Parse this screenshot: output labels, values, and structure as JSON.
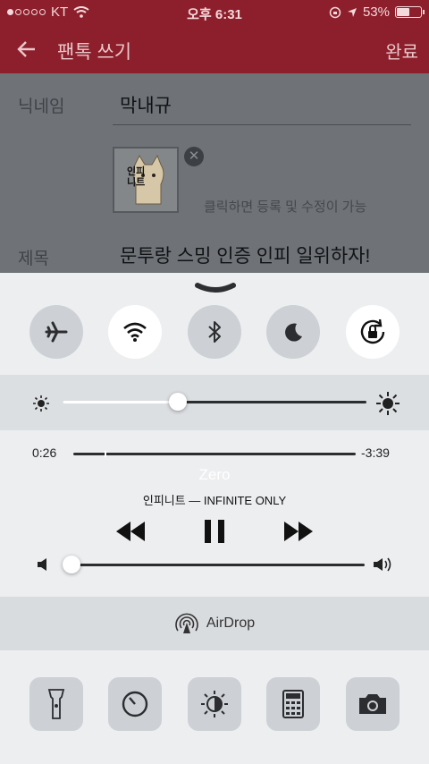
{
  "status_bar": {
    "carrier": "KT",
    "time": "오후 6:31",
    "battery": "53%",
    "battery_level": 0.53
  },
  "navbar": {
    "back_icon": "back-arrow-icon",
    "title": "팬톡 쓰기",
    "done_label": "완료"
  },
  "form": {
    "nickname_label": "닉네임",
    "nickname_value": "막내규",
    "image_hint": "클릭하면 등록 및 수정이 가능",
    "image_caption": "인피니트",
    "subject_label": "제목",
    "subject_value": "문투랑 스밍 인증 인피 일위하자!"
  },
  "control_center": {
    "toggles": [
      {
        "name": "airplane-mode",
        "icon": "airplane-icon",
        "on": false
      },
      {
        "name": "wifi",
        "icon": "wifi-icon",
        "on": true
      },
      {
        "name": "bluetooth",
        "icon": "bluetooth-icon",
        "on": false
      },
      {
        "name": "do-not-disturb",
        "icon": "moon-icon",
        "on": false
      },
      {
        "name": "rotation-lock",
        "icon": "rotation-lock-icon",
        "on": true
      }
    ],
    "brightness_level": 0.38,
    "music": {
      "elapsed": "0:26",
      "remaining": "-3:39",
      "progress": 0.11,
      "song": "Zero",
      "artist_album": "인피니트 — INFINITE ONLY",
      "volume_level": 0.0
    },
    "airdrop_label": "AirDrop",
    "shortcuts": [
      "flashlight-icon",
      "timer-icon",
      "night-shift-icon",
      "calculator-icon",
      "camera-icon"
    ]
  }
}
